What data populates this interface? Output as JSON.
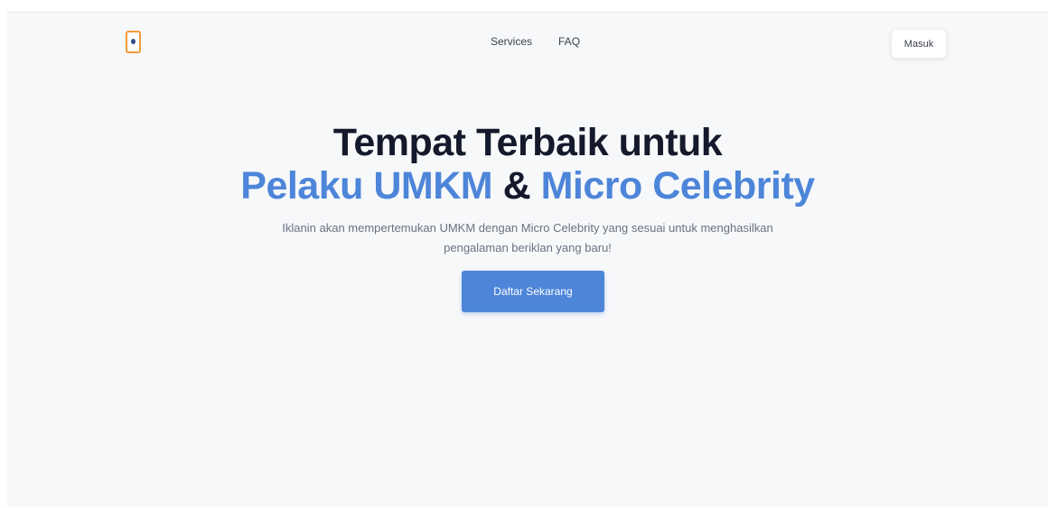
{
  "navbar": {
    "logo_icon": "phone-icon",
    "links": [
      "Services",
      "FAQ"
    ],
    "login_label": "Masuk"
  },
  "hero": {
    "headline_line1": "Tempat Terbaik untuk",
    "headline_part1": "Pelaku UMKM",
    "headline_amp": "&",
    "headline_part2": "Micro Celebrity",
    "subtitle": "Iklanin akan mempertemukan UMKM dengan Micro Celebrity yang sesuai untuk menghasilkan pengalaman beriklan yang baru!",
    "cta_label": "Daftar Sekarang"
  },
  "colors": {
    "accent": "#4d85d9",
    "heading_dark": "#141a2b",
    "background": "#f7f8fa",
    "logo_border": "#f29a3a"
  }
}
